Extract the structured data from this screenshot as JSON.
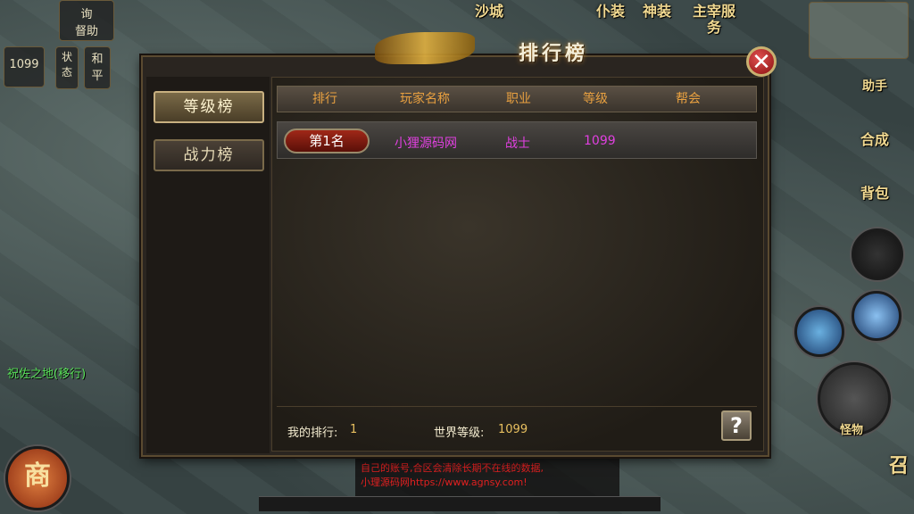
{
  "hud": {
    "top_left_btn1": "询\n督助",
    "top_left_btn2": "1099",
    "status_btn": "状\n态",
    "peace_btn": "和\n平",
    "map_name": "祝佐之地(移行)",
    "top_menu": [
      "沙城",
      "仆装",
      "神装",
      "主宰服务"
    ],
    "right_menu": [
      "助手",
      "合成",
      "背包"
    ],
    "shop_label": "商",
    "summon_label": "召",
    "monster_label": "怪物",
    "chat_lines": [
      "自己的账号,合区会清除长期不在线的数据,",
      "小理源码网https://www.agnsy.com!"
    ]
  },
  "panel": {
    "title": "排行榜",
    "tabs": [
      {
        "label": "等级榜",
        "active": true
      },
      {
        "label": "战力榜",
        "active": false
      }
    ],
    "columns": [
      "排行",
      "玩家名称",
      "职业",
      "等级",
      "帮会"
    ],
    "rows": [
      {
        "rank": "第1名",
        "name": "小狸源码网",
        "class": "战士",
        "level": "1099",
        "guild": ""
      }
    ],
    "footer": {
      "my_rank_label": "我的排行:",
      "my_rank_value": "1",
      "world_level_label": "世界等级:",
      "world_level_value": "1099"
    },
    "help_label": "?",
    "close_label": "✕"
  },
  "colors": {
    "header_text": "#e8a040",
    "row_text": "#e040e0",
    "accent_gold": "#c8b080"
  }
}
